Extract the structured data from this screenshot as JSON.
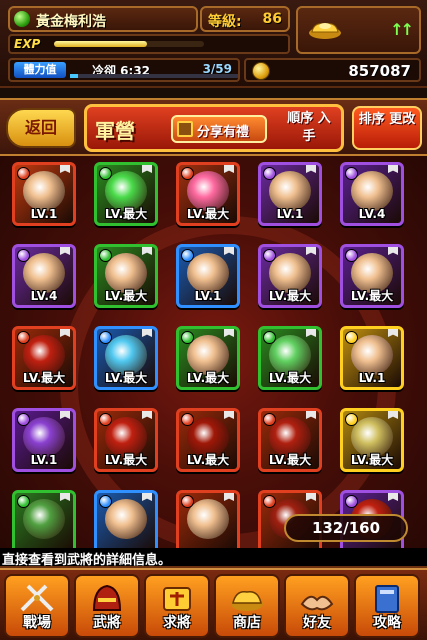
{
  "status": {
    "player_name": "黃金梅利浩",
    "level_label": "等級:",
    "level_value": "86",
    "exp_label": "EXP",
    "exp_progress": 0.62,
    "stamina_label": "體力值",
    "cooldown": "冷卻 6:32",
    "stamina": "3/59",
    "stamina_progress": 0.05,
    "gold_trend": "↑↑",
    "coins": "857087"
  },
  "titlebar": {
    "back_label": "返回",
    "title": "軍營",
    "share_label": "分享有禮",
    "order_label": "順序 入手",
    "sort_label": "排序 更改"
  },
  "grid": {
    "rows": [
      [
        {
          "lv": "LV.1",
          "elem": "#e04020",
          "bg": "#c03a10",
          "face": "#f0c090"
        },
        {
          "lv": "LV.最大",
          "elem": "#30c030",
          "bg": "#2a8a20",
          "face": "#4adb4a"
        },
        {
          "lv": "LV.最大",
          "elem": "#e04020",
          "bg": "#a03010",
          "face": "#ff6aa0"
        },
        {
          "lv": "LV.1",
          "elem": "#a050e0",
          "bg": "#6a2aa0",
          "face": "#f0c090"
        },
        {
          "lv": "LV.4",
          "elem": "#a050e0",
          "bg": "#5a2090",
          "face": "#f0c090"
        }
      ],
      [
        {
          "lv": "LV.4",
          "elem": "#a050e0",
          "bg": "#6a2aa0",
          "face": "#f0c090"
        },
        {
          "lv": "LV.最大",
          "elem": "#30c030",
          "bg": "#2a8a20",
          "face": "#f0c090"
        },
        {
          "lv": "LV.1",
          "elem": "#3090ff",
          "bg": "#1a5ab0",
          "face": "#f0c090"
        },
        {
          "lv": "LV.最大",
          "elem": "#a050e0",
          "bg": "#6a2aa0",
          "face": "#f0c090"
        },
        {
          "lv": "LV.最大",
          "elem": "#a050e0",
          "bg": "#5a2090",
          "face": "#f0c090"
        }
      ],
      [
        {
          "lv": "LV.最大",
          "elem": "#e04020",
          "bg": "#9a2a0a",
          "face": "#c02010"
        },
        {
          "lv": "LV.最大",
          "elem": "#3090ff",
          "bg": "#1a5ab0",
          "face": "#50c8f0"
        },
        {
          "lv": "LV.最大",
          "elem": "#30c030",
          "bg": "#2a8a20",
          "face": "#f0c090"
        },
        {
          "lv": "LV.最大",
          "elem": "#30c030",
          "bg": "#2a8a20",
          "face": "#60d060"
        },
        {
          "lv": "LV.1",
          "elem": "#ffd020",
          "bg": "#c09010",
          "face": "#f0c090"
        }
      ],
      [
        {
          "lv": "LV.1",
          "elem": "#a050e0",
          "bg": "#5a1a90",
          "face": "#8a40d0"
        },
        {
          "lv": "LV.最大",
          "elem": "#e04020",
          "bg": "#9a2a0a",
          "face": "#c02010"
        },
        {
          "lv": "LV.最大",
          "elem": "#e04020",
          "bg": "#9a2a0a",
          "face": "#a01808"
        },
        {
          "lv": "LV.最大",
          "elem": "#e04020",
          "bg": "#9a2a0a",
          "face": "#b02010"
        },
        {
          "lv": "LV.最大",
          "elem": "#ffd020",
          "bg": "#b08810",
          "face": "#d0c060"
        }
      ],
      [
        {
          "lv": "",
          "elem": "#30c030",
          "bg": "#2a7a20",
          "face": "#50a040"
        },
        {
          "lv": "",
          "elem": "#3090ff",
          "bg": "#1a5ab0",
          "face": "#f0c090"
        },
        {
          "lv": "",
          "elem": "#e04020",
          "bg": "#9a2a0a",
          "face": "#f0c090"
        },
        {
          "lv": "",
          "elem": "#e04020",
          "bg": "#9a2a0a",
          "face": "#a02010"
        },
        {
          "lv": "",
          "elem": "#a050e0",
          "bg": "#5a2090",
          "face": "#c02010"
        }
      ]
    ]
  },
  "counter": "132/160",
  "info_text": "直接查看到武將的詳細信息。",
  "nav": [
    {
      "label": "戰場",
      "icon": "swords-icon"
    },
    {
      "label": "武將",
      "icon": "warrior-helmet-icon"
    },
    {
      "label": "求將",
      "icon": "recruit-icon"
    },
    {
      "label": "商店",
      "icon": "gold-ingot-icon"
    },
    {
      "label": "好友",
      "icon": "friends-hands-icon"
    },
    {
      "label": "攻略",
      "icon": "guide-book-icon"
    }
  ]
}
